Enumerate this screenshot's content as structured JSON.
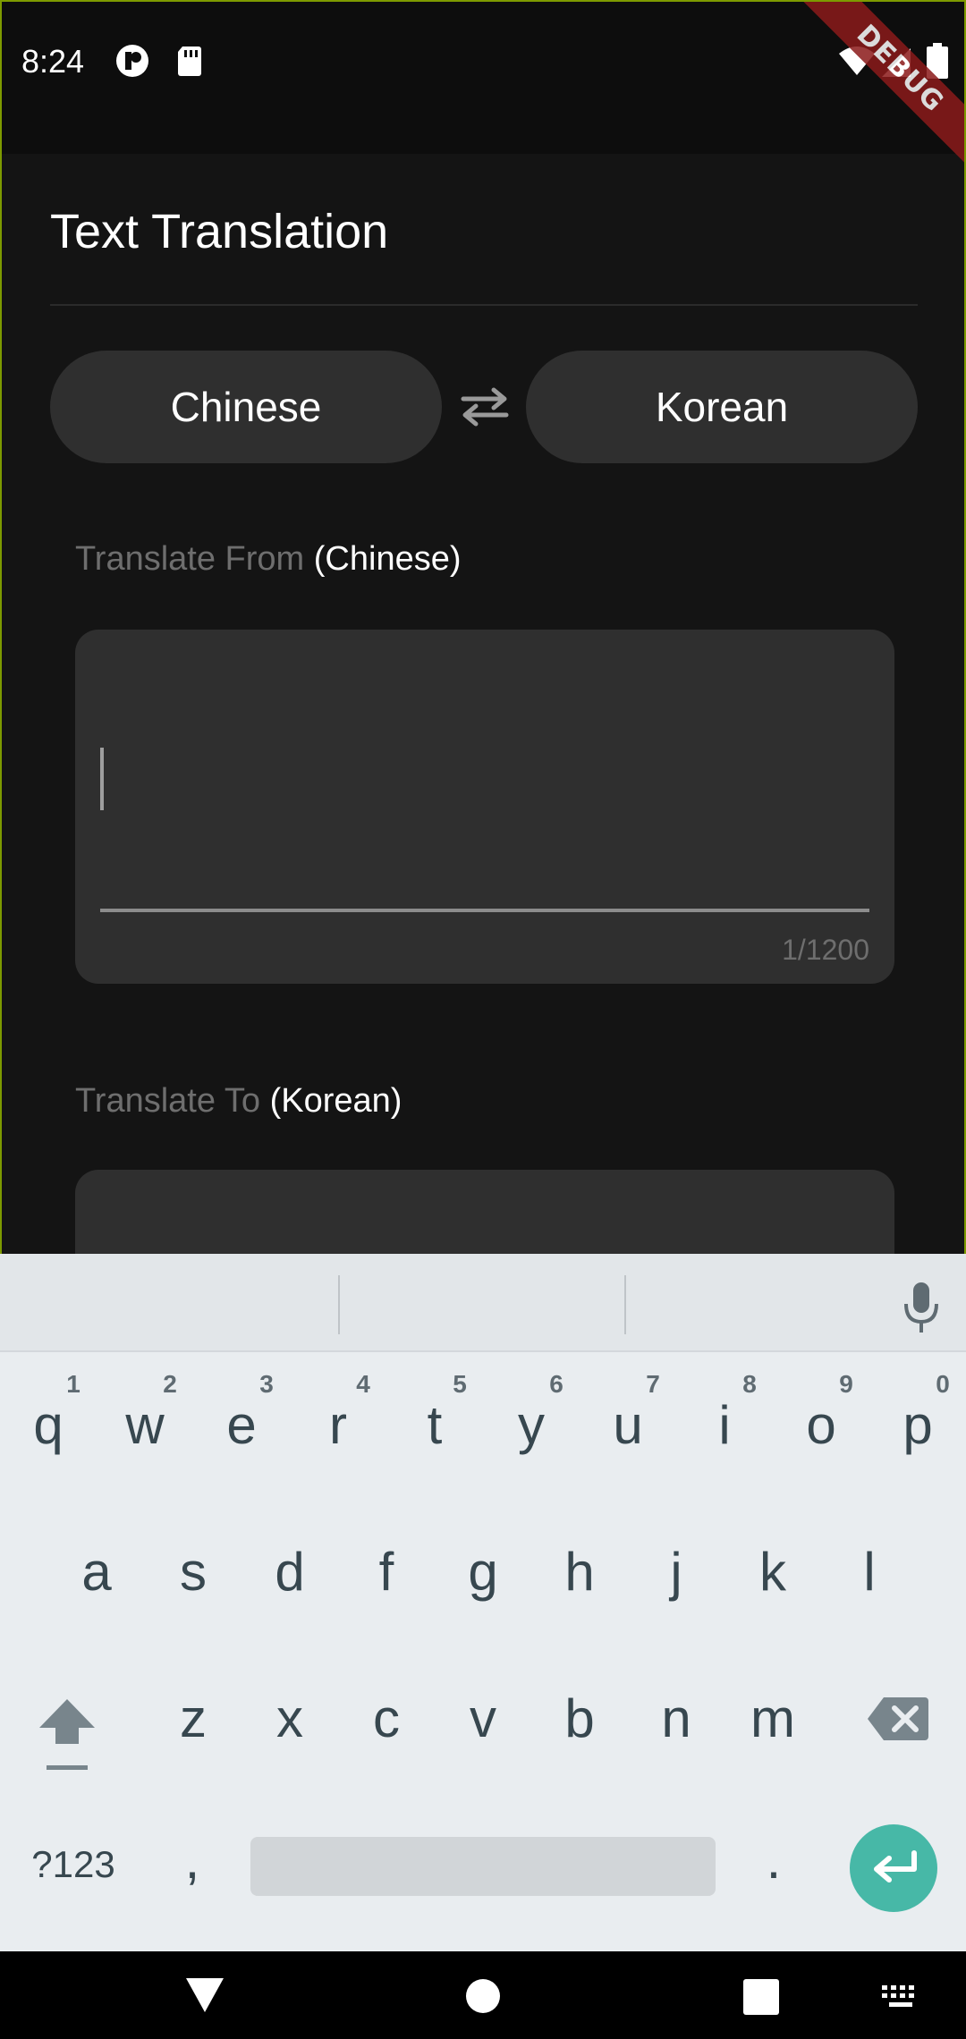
{
  "status_bar": {
    "time": "8:24",
    "debug_label": "DEBUG",
    "icons": [
      "app-notification-icon",
      "sd-card-icon",
      "wifi-icon",
      "signal-icon",
      "battery-icon"
    ]
  },
  "header": {
    "title": "Text Translation"
  },
  "language_selector": {
    "source": "Chinese",
    "target": "Korean",
    "swap_icon": "swap-arrows-icon"
  },
  "source_section": {
    "label_prefix": "Translate From",
    "label_lang": "(Chinese)",
    "input_value": "",
    "counter": "1/1200"
  },
  "target_section": {
    "label_prefix": "Translate To",
    "label_lang": "(Korean)"
  },
  "keyboard": {
    "row1": [
      {
        "key": "q",
        "hint": "1"
      },
      {
        "key": "w",
        "hint": "2"
      },
      {
        "key": "e",
        "hint": "3"
      },
      {
        "key": "r",
        "hint": "4"
      },
      {
        "key": "t",
        "hint": "5"
      },
      {
        "key": "y",
        "hint": "6"
      },
      {
        "key": "u",
        "hint": "7"
      },
      {
        "key": "i",
        "hint": "8"
      },
      {
        "key": "o",
        "hint": "9"
      },
      {
        "key": "p",
        "hint": "0"
      }
    ],
    "row2": [
      "a",
      "s",
      "d",
      "f",
      "g",
      "h",
      "j",
      "k",
      "l"
    ],
    "row3": [
      "z",
      "x",
      "c",
      "v",
      "b",
      "n",
      "m"
    ],
    "symbols_key": "?123",
    "comma_key": ",",
    "period_key": ".",
    "icons": [
      "microphone-icon",
      "shift-icon",
      "backspace-icon",
      "enter-icon"
    ]
  },
  "nav_bar": {
    "icons": [
      "back-icon",
      "home-icon",
      "recents-icon",
      "keyboard-switch-icon"
    ]
  },
  "colors": {
    "background": "#141414",
    "card": "#2f2f2f",
    "accent_enter": "#47b8a7",
    "debug_banner": "#8b1a1a",
    "frame_border": "#7d9a00"
  }
}
